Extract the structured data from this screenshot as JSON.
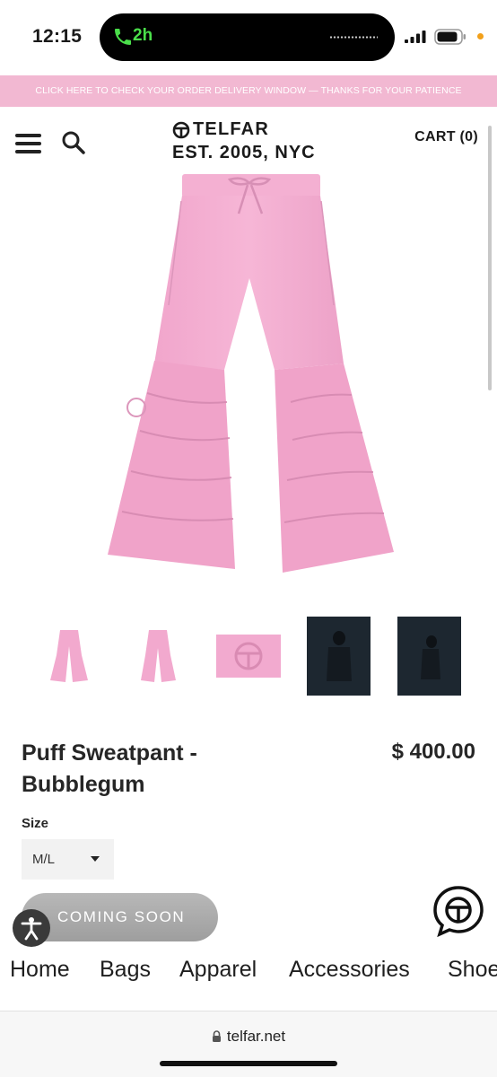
{
  "status_bar": {
    "time": "12:15",
    "call_duration": "2h",
    "call_color": "#4ade4a",
    "battery_icon": "battery-icon",
    "signal_icon": "signal-icon"
  },
  "announcement": {
    "text": "CLICK HERE TO CHECK YOUR ORDER DELIVERY WINDOW — THANKS FOR YOUR PATIENCE",
    "background": "#f2b8d2"
  },
  "header": {
    "brand": "TELFAR",
    "tagline": "EST. 2005, NYC",
    "cart_label": "CART (0)",
    "menu_icon": "hamburger-menu-icon",
    "search_icon": "search-icon"
  },
  "product": {
    "name": "Puff Sweatpant - Bubblegum",
    "price": "$ 400.00",
    "color": "#f2aacf",
    "size_label": "Size",
    "size_selected": "M/L",
    "cta_label": "COMING SOON",
    "thumbnails": [
      "front-view",
      "side-view",
      "logo-detail",
      "model-photo-1",
      "model-photo-2"
    ]
  },
  "nav_categories": [
    "Home",
    "Bags",
    "Apparel",
    "Accessories",
    "Shoes"
  ],
  "browser": {
    "url": "telfar.net"
  }
}
